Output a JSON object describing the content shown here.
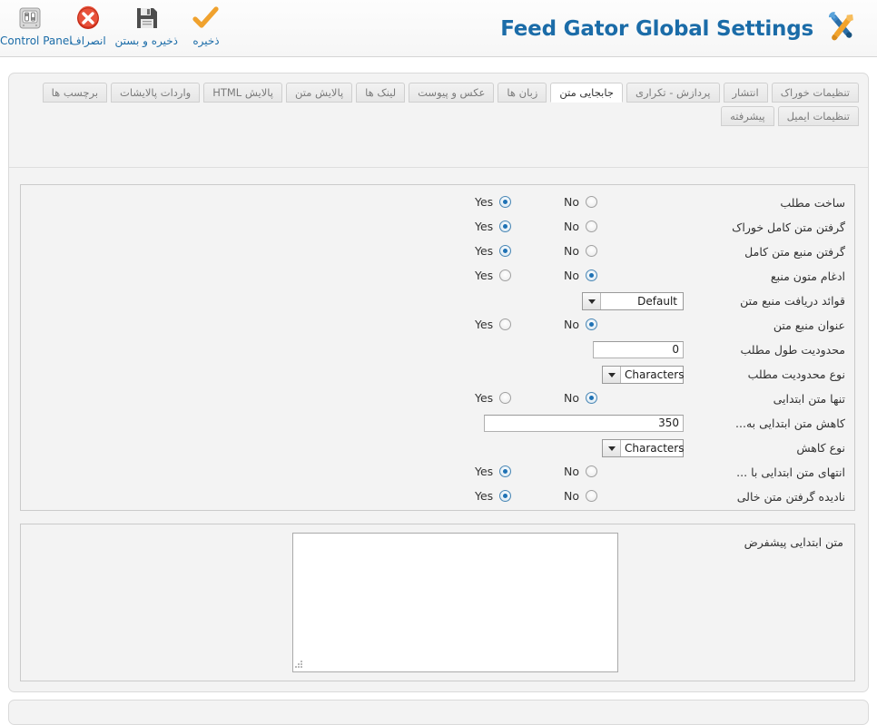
{
  "toolbar": {
    "buttons": [
      {
        "label": "Control Panel",
        "icon": "control-panel-icon",
        "dir": "ltr"
      },
      {
        "label": "انصراف",
        "icon": "cancel-icon",
        "dir": "rtl"
      },
      {
        "label": "ذخیره و بستن",
        "icon": "save-close-icon",
        "dir": "rtl"
      },
      {
        "label": "ذخیره",
        "icon": "save-icon",
        "dir": "rtl"
      }
    ]
  },
  "header": {
    "title": "Feed Gator Global Settings",
    "title_icon": "tools-icon",
    "title_color": "#1b6ca8"
  },
  "tabs": {
    "row1": [
      {
        "label": "تنظیمات خوراک",
        "active": false
      },
      {
        "label": "انتشار",
        "active": false
      },
      {
        "label": "پردازش - تکراری",
        "active": false
      },
      {
        "label": "جابجایی متن",
        "active": true
      },
      {
        "label": "زبان ها",
        "active": false
      },
      {
        "label": "عکس و پیوست",
        "active": false
      },
      {
        "label": "لینک ها",
        "active": false
      },
      {
        "label": "پالایش متن",
        "active": false
      },
      {
        "label": "پالایش HTML",
        "active": false
      },
      {
        "label": "واردات پالایشات",
        "active": false
      },
      {
        "label": "برچسب ها",
        "active": false
      }
    ],
    "row2": [
      {
        "label": "تنظیمات ایمیل",
        "active": false
      },
      {
        "label": "پیشرفته",
        "active": false
      }
    ]
  },
  "radio_labels": {
    "yes": "Yes",
    "no": "No"
  },
  "settings_rows": [
    {
      "label": "ساخت مطلب",
      "control": "radio",
      "value": "yes"
    },
    {
      "label": "گرفتن متن کامل خوراک",
      "control": "radio",
      "value": "yes"
    },
    {
      "label": "گرفتن منبع متن کامل",
      "control": "radio",
      "value": "yes"
    },
    {
      "label": "ادغام متون منبع",
      "control": "radio",
      "value": "no"
    },
    {
      "label": "قوائد دریافت منبع متن",
      "control": "select",
      "value": "Default"
    },
    {
      "label": "عنوان منبع متن",
      "control": "radio",
      "value": "no"
    },
    {
      "label": "محدودیت طول مطلب",
      "control": "text",
      "value": "0"
    },
    {
      "label": "نوع محدودیت مطلب",
      "control": "select",
      "value": "Characters"
    },
    {
      "label": "تنها متن ابتدایی",
      "control": "radio",
      "value": "no"
    },
    {
      "label": "کاهش متن ابتدایی به...",
      "control": "text",
      "value": "350"
    },
    {
      "label": "نوع کاهش",
      "control": "select",
      "value": "Characters"
    },
    {
      "label": "انتهای متن ابتدایی با ...",
      "control": "radio",
      "value": "yes"
    },
    {
      "label": "نادیده گرفتن متن خالی",
      "control": "radio",
      "value": "yes"
    }
  ],
  "textarea_section": {
    "label": "متن ابتدایی پیشفرض",
    "value": "",
    "resize_grip": "resize-grip-icon"
  }
}
